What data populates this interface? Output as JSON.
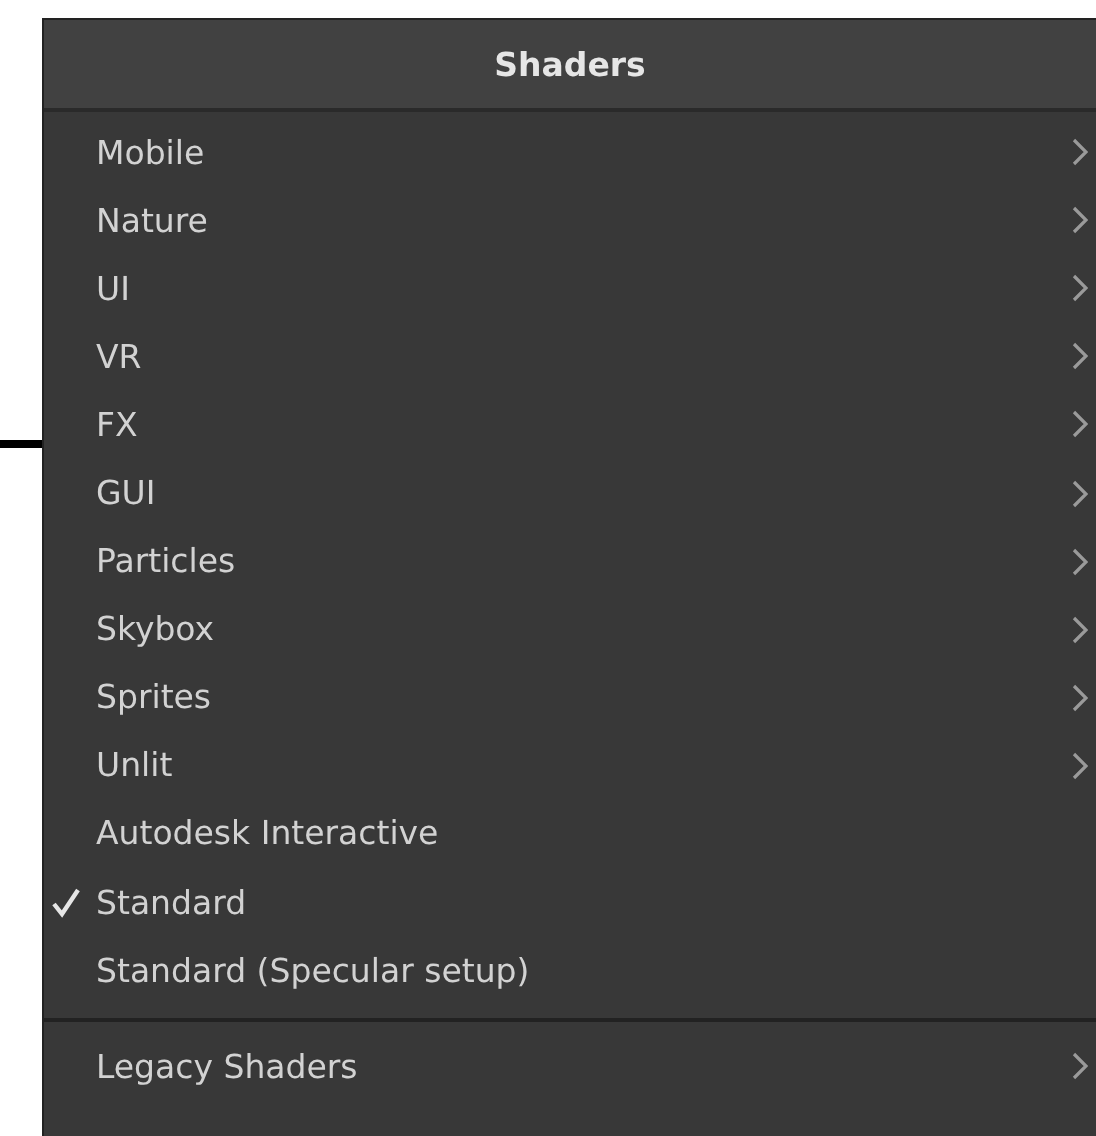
{
  "menu": {
    "title": "Shaders",
    "items": [
      {
        "label": "Mobile",
        "checked": false,
        "submenu": true
      },
      {
        "label": "Nature",
        "checked": false,
        "submenu": true
      },
      {
        "label": "UI",
        "checked": false,
        "submenu": true
      },
      {
        "label": "VR",
        "checked": false,
        "submenu": true
      },
      {
        "label": "FX",
        "checked": false,
        "submenu": true
      },
      {
        "label": "GUI",
        "checked": false,
        "submenu": true
      },
      {
        "label": "Particles",
        "checked": false,
        "submenu": true
      },
      {
        "label": "Skybox",
        "checked": false,
        "submenu": true
      },
      {
        "label": "Sprites",
        "checked": false,
        "submenu": true
      },
      {
        "label": "Unlit",
        "checked": false,
        "submenu": true
      },
      {
        "label": "Autodesk Interactive",
        "checked": false,
        "submenu": false
      },
      {
        "label": "Standard",
        "checked": true,
        "submenu": false
      },
      {
        "label": "Standard (Specular setup)",
        "checked": false,
        "submenu": false
      }
    ],
    "footer_items": [
      {
        "label": "Legacy Shaders",
        "checked": false,
        "submenu": true
      }
    ]
  }
}
